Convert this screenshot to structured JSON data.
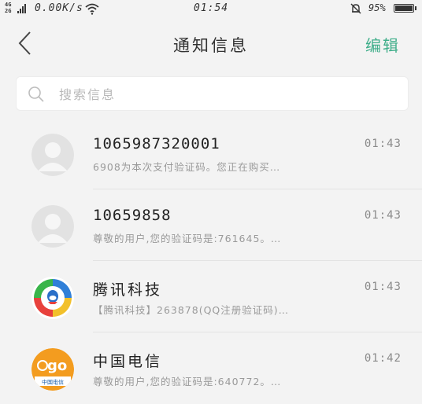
{
  "status_bar": {
    "network_top": "4G",
    "network_bottom": "2G",
    "speed": "0.00K/s",
    "time": "01:54",
    "battery": "95%"
  },
  "header": {
    "title": "通知信息",
    "edit_label": "编辑"
  },
  "search": {
    "placeholder": "搜索信息"
  },
  "messages": [
    {
      "sender": "1065987320001",
      "time": "01:43",
      "preview": "6908为本次支付验证码。您正在购买…",
      "avatar": "default-contact-avatar"
    },
    {
      "sender": "10659858",
      "time": "01:43",
      "preview": "尊敬的用户,您的验证码是:761645。…",
      "avatar": "default-contact-avatar"
    },
    {
      "sender": "腾讯科技",
      "time": "01:43",
      "preview": "【腾讯科技】263878(QQ注册验证码)…",
      "avatar": "tencent-news-logo"
    },
    {
      "sender": "中国电信",
      "time": "01:42",
      "preview": "尊敬的用户,您的验证码是:640772。…",
      "avatar": "china-telecom-logo",
      "logo_text": "go",
      "logo_subtext": "中国电信"
    }
  ],
  "colors": {
    "accent": "#3fae8a",
    "background": "#f3f3f3"
  }
}
